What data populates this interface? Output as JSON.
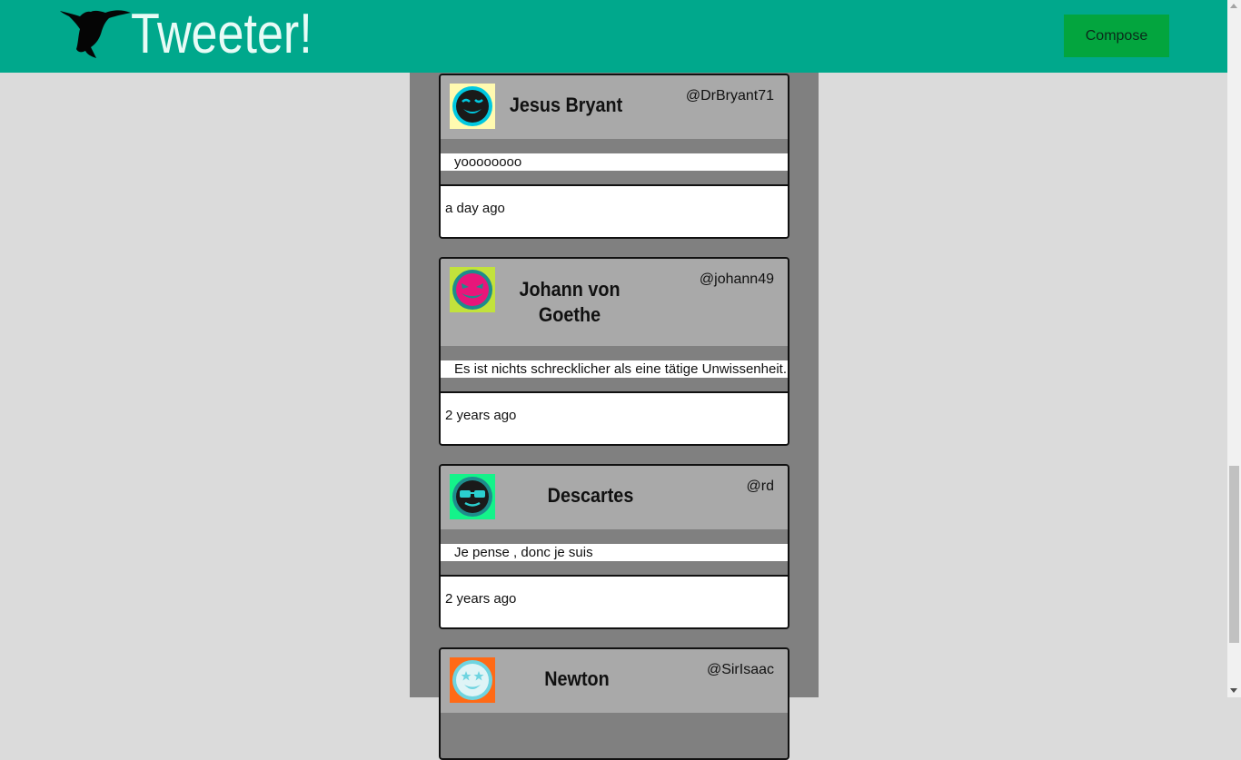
{
  "header": {
    "brand": "Tweeter!",
    "compose_label": "Compose",
    "logo_icon": "hummingbird-icon"
  },
  "colors": {
    "nav": "#00a88c",
    "compose": "#03a53e",
    "feed": "#808080",
    "card_header": "#a9a9a9",
    "page": "#dbdbdb"
  },
  "tweets": [
    {
      "name": "Jesus Bryant",
      "handle": "@DrBryant71",
      "text": "yoooooooo",
      "time": "a day ago",
      "avatar_icon": "winking-face-icon",
      "avatar_bg": "#fffab0",
      "avatar_ring": "#00c8e0"
    },
    {
      "name": "Johann von Goethe",
      "handle": "@johann49",
      "text": "Es ist nichts schrecklicher als eine tätige Unwissenheit.",
      "time": "2 years ago",
      "avatar_icon": "devil-grin-face-icon",
      "avatar_bg": "#c2e23c",
      "avatar_ring": "#1e8c8c"
    },
    {
      "name": "Descartes",
      "handle": "@rd",
      "text": "Je pense , donc je suis",
      "time": "2 years ago",
      "avatar_icon": "sunglasses-face-icon",
      "avatar_bg": "#14f38a",
      "avatar_ring": "#1e8c8c"
    },
    {
      "name": "Newton",
      "handle": "@SirIsaac",
      "text": "",
      "time": "",
      "avatar_icon": "star-eyes-face-icon",
      "avatar_bg": "#ff6a16",
      "avatar_ring": "#6fd4e0"
    }
  ]
}
